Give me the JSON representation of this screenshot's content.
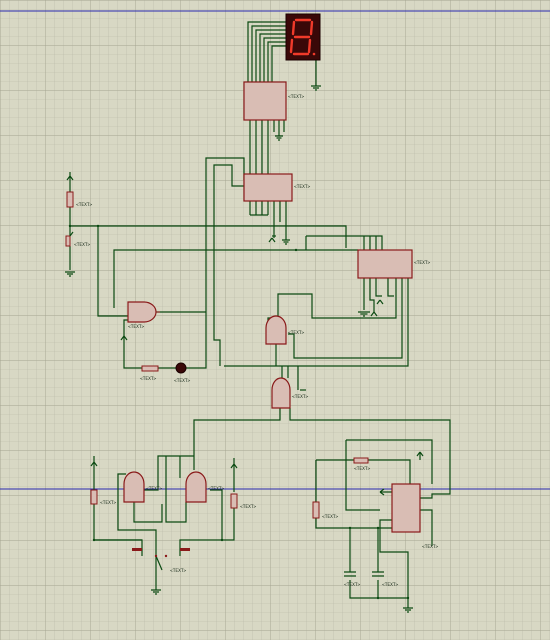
{
  "schematic": {
    "grid": {
      "minor_color": "#b8b8a6",
      "major_color": "#a5a590",
      "background": "#d8d8c4"
    },
    "colors": {
      "wire": "#0b4a12",
      "component_fill": "#d9bdb4",
      "component_outline": "#8a1a1a",
      "seven_segment_body": "#3a0808",
      "seven_segment_on": "#f03a2a",
      "axis_line": "#2a2ab0"
    },
    "seven_segment_display": {
      "digit_shown": "8"
    },
    "component_labels": {
      "u_decoder": "<TEXT>",
      "u_counter": "<TEXT>",
      "u_register": "<TEXT>",
      "u_and_main": "<TEXT>",
      "u_and_right_top": "<TEXT>",
      "u_and_right_bottom": "<TEXT>",
      "u_timer": "<TEXT>",
      "u_and_bottom_left": "<TEXT>",
      "u_and_bottom_right": "<TEXT>",
      "r_pullup_top": "<TEXT>",
      "r_series": "<TEXT>",
      "r_bottom_left": "<TEXT>",
      "r_bottom_right": "<TEXT>",
      "r_timer_top": "<TEXT>",
      "r_timer_left": "<TEXT>",
      "sw_top": "<TEXT>",
      "sw_bottom": "<TEXT>",
      "led": "<TEXT>",
      "c_timer_left": "<TEXT>",
      "c_timer_right": "<TEXT>"
    }
  }
}
